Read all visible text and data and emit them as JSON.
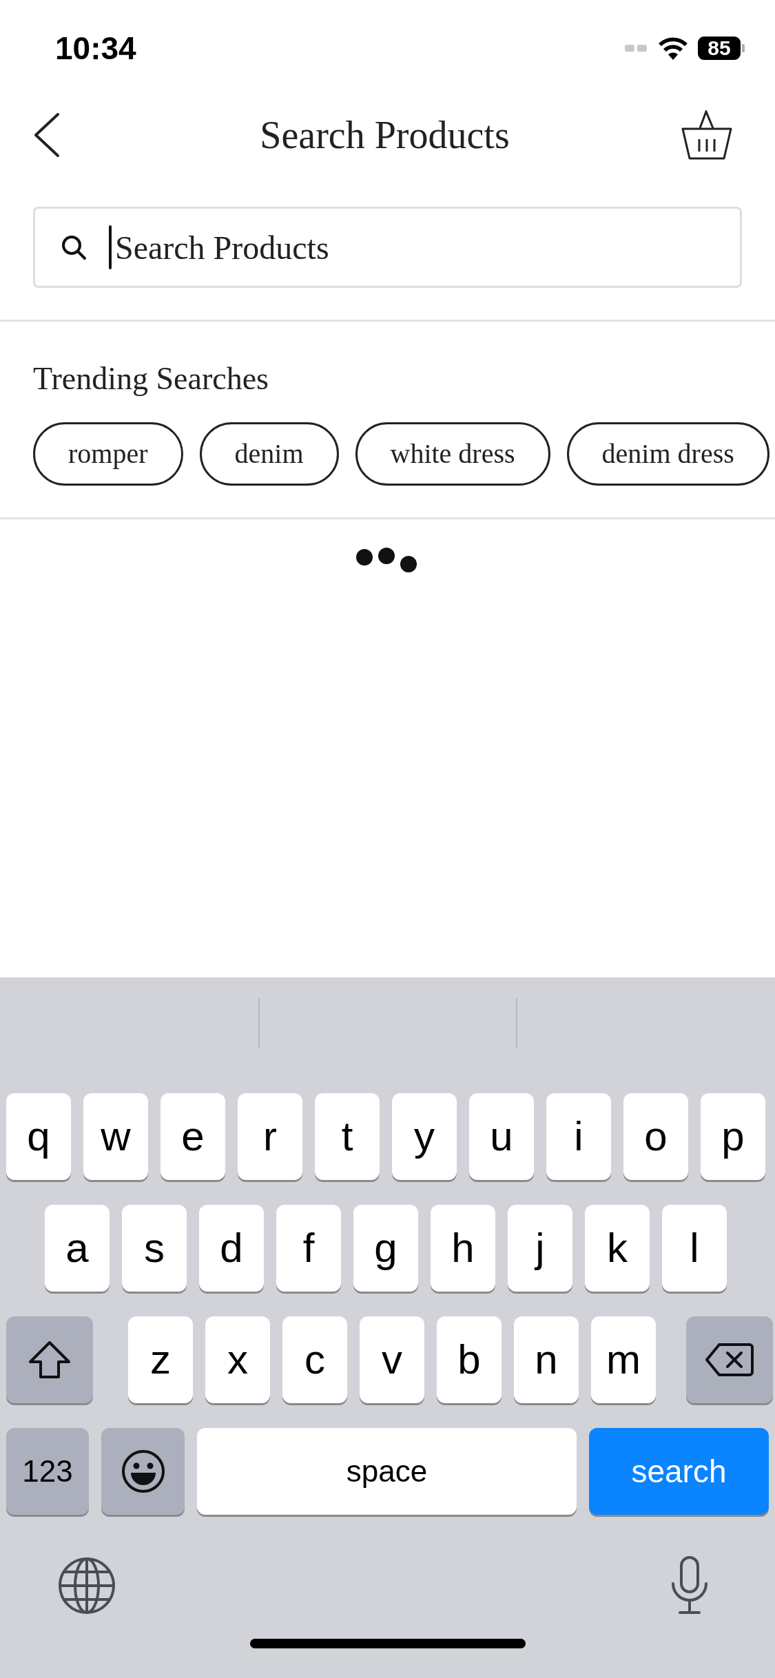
{
  "status_bar": {
    "time": "10:34",
    "battery": "85"
  },
  "header": {
    "title": "Search Products"
  },
  "search": {
    "placeholder": "Search Products",
    "focused": true
  },
  "trending": {
    "title": "Trending Searches",
    "chips": [
      "romper",
      "denim",
      "white dress",
      "denim dress"
    ]
  },
  "loading": true,
  "keyboard": {
    "rows": [
      {
        "keys": [
          {
            "kind": "letter",
            "label": "q"
          },
          {
            "kind": "letter",
            "label": "w"
          },
          {
            "kind": "letter",
            "label": "e"
          },
          {
            "kind": "letter",
            "label": "r"
          },
          {
            "kind": "letter",
            "label": "t"
          },
          {
            "kind": "letter",
            "label": "y"
          },
          {
            "kind": "letter",
            "label": "u"
          },
          {
            "kind": "letter",
            "label": "i"
          },
          {
            "kind": "letter",
            "label": "o"
          },
          {
            "kind": "letter",
            "label": "p"
          }
        ]
      },
      {
        "keys": [
          {
            "kind": "letter",
            "label": "a"
          },
          {
            "kind": "letter",
            "label": "s"
          },
          {
            "kind": "letter",
            "label": "d"
          },
          {
            "kind": "letter",
            "label": "f"
          },
          {
            "kind": "letter",
            "label": "g"
          },
          {
            "kind": "letter",
            "label": "h"
          },
          {
            "kind": "letter",
            "label": "j"
          },
          {
            "kind": "letter",
            "label": "k"
          },
          {
            "kind": "letter",
            "label": "l"
          }
        ]
      },
      {
        "keys": [
          {
            "kind": "shift"
          },
          {
            "kind": "letter",
            "label": "z"
          },
          {
            "kind": "letter",
            "label": "x"
          },
          {
            "kind": "letter",
            "label": "c"
          },
          {
            "kind": "letter",
            "label": "v"
          },
          {
            "kind": "letter",
            "label": "b"
          },
          {
            "kind": "letter",
            "label": "n"
          },
          {
            "kind": "letter",
            "label": "m"
          },
          {
            "kind": "delete"
          }
        ]
      },
      {
        "keys": [
          {
            "kind": "mode",
            "label": "123"
          },
          {
            "kind": "emoji"
          },
          {
            "kind": "space",
            "label": "space"
          },
          {
            "kind": "return",
            "label": "search"
          }
        ]
      }
    ]
  }
}
